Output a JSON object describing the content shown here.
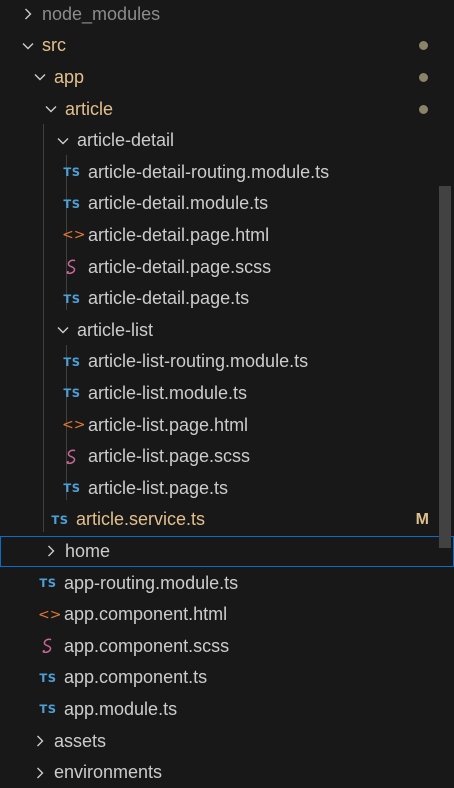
{
  "explorer": {
    "items": [
      {
        "label": "node_modules",
        "type": "folder",
        "expanded": false,
        "status": "ignored"
      },
      {
        "label": "src",
        "type": "folder",
        "expanded": true,
        "status": "dot"
      },
      {
        "label": "app",
        "type": "folder",
        "expanded": true,
        "status": "dot"
      },
      {
        "label": "article",
        "type": "folder",
        "expanded": true,
        "status": "dot"
      },
      {
        "label": "article-detail",
        "type": "folder",
        "expanded": true
      },
      {
        "label": "article-detail-routing.module.ts",
        "type": "ts"
      },
      {
        "label": "article-detail.module.ts",
        "type": "ts"
      },
      {
        "label": "article-detail.page.html",
        "type": "html"
      },
      {
        "label": "article-detail.page.scss",
        "type": "scss"
      },
      {
        "label": "article-detail.page.ts",
        "type": "ts"
      },
      {
        "label": "article-list",
        "type": "folder",
        "expanded": true
      },
      {
        "label": "article-list-routing.module.ts",
        "type": "ts"
      },
      {
        "label": "article-list.module.ts",
        "type": "ts"
      },
      {
        "label": "article-list.page.html",
        "type": "html"
      },
      {
        "label": "article-list.page.scss",
        "type": "scss"
      },
      {
        "label": "article-list.page.ts",
        "type": "ts"
      },
      {
        "label": "article.service.ts",
        "type": "ts",
        "status": "M"
      },
      {
        "label": "home",
        "type": "folder",
        "expanded": false,
        "selected": true
      },
      {
        "label": "app-routing.module.ts",
        "type": "ts"
      },
      {
        "label": "app.component.html",
        "type": "html"
      },
      {
        "label": "app.component.scss",
        "type": "scss"
      },
      {
        "label": "app.component.ts",
        "type": "ts"
      },
      {
        "label": "app.module.ts",
        "type": "ts"
      },
      {
        "label": "assets",
        "type": "folder",
        "expanded": false
      },
      {
        "label": "environments",
        "type": "folder",
        "expanded": false
      }
    ]
  },
  "icons": {
    "ts_glyph": "TS",
    "html_glyph": "<>",
    "ts_color": "#4d9fd6",
    "html_color": "#e37933",
    "scss_color": "#cd6799",
    "modified_color": "#e2c08d"
  }
}
